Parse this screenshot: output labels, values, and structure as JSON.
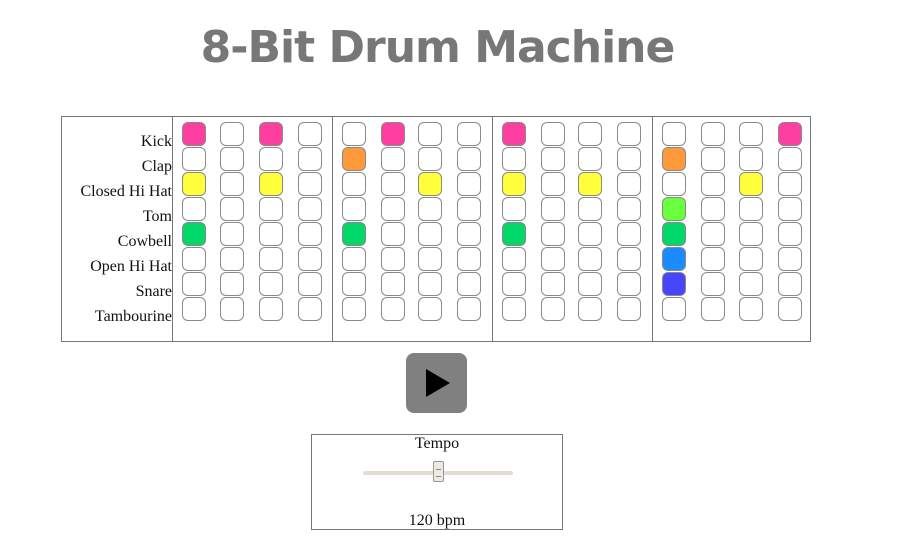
{
  "title": "8-Bit Drum Machine",
  "instruments": [
    {
      "name": "Kick",
      "color": "#ff3fa0",
      "active": [
        0,
        2,
        5,
        8,
        15
      ]
    },
    {
      "name": "Clap",
      "color": "#ff9a3c",
      "active": [
        4,
        12
      ]
    },
    {
      "name": "Closed Hi Hat",
      "color": "#ffff3c",
      "active": [
        0,
        2,
        6,
        8,
        10,
        14
      ]
    },
    {
      "name": "Tom",
      "color": "#6aff3c",
      "active": [
        12
      ]
    },
    {
      "name": "Cowbell",
      "color": "#00d96a",
      "active": [
        0,
        4,
        8,
        12
      ]
    },
    {
      "name": "Open Hi Hat",
      "color": "#1a8cff",
      "active": [
        12
      ]
    },
    {
      "name": "Snare",
      "color": "#4646ff",
      "active": [
        12
      ]
    },
    {
      "name": "Tambourine",
      "color": "#c0c0c0",
      "active": []
    }
  ],
  "steps": 16,
  "play_icon": "play-icon",
  "tempo": {
    "label": "Tempo",
    "value": 120,
    "min": 60,
    "max": 180,
    "display": "120 bpm"
  }
}
